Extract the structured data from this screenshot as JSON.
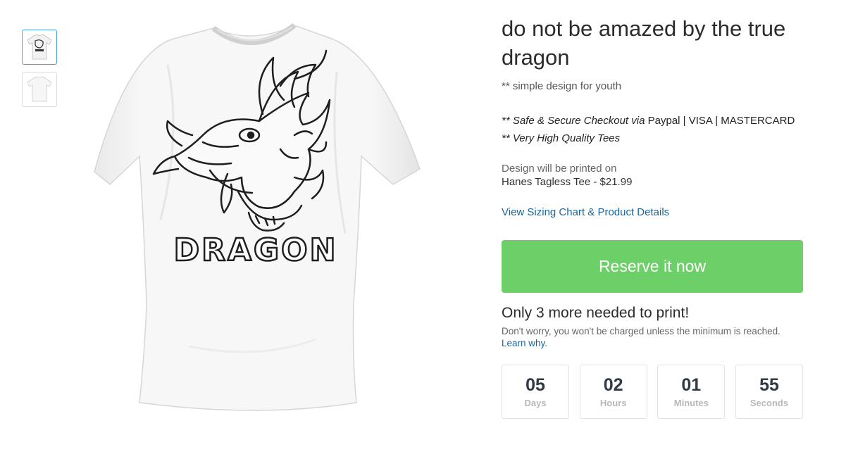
{
  "product": {
    "title": "do not be amazed by the true dragon",
    "description": "** simple design for youth",
    "checkout_line1_prefix": "** Safe & Secure Checkout via",
    "checkout_line1_methods": " Paypal | VISA | MASTERCARD",
    "checkout_line2": "** Very High Quality Tees",
    "printed_label": "Design will be printed on",
    "product_line": "Hanes Tagless Tee - $21.99",
    "sizing_link": "View Sizing Chart & Product Details",
    "reserve_label": "Reserve it now",
    "needed_text": "Only 3 more needed to print!",
    "worry_text": "Don't worry, you won't be charged unless the minimum is reached.",
    "learn_link": "Learn why."
  },
  "shirt_print": {
    "text": "DRAGON"
  },
  "countdown": [
    {
      "value": "05",
      "label": "Days"
    },
    {
      "value": "02",
      "label": "Hours"
    },
    {
      "value": "01",
      "label": "Minutes"
    },
    {
      "value": "55",
      "label": "Seconds"
    }
  ],
  "thumbnails": [
    {
      "name": "front",
      "active": true
    },
    {
      "name": "back",
      "active": false
    }
  ]
}
